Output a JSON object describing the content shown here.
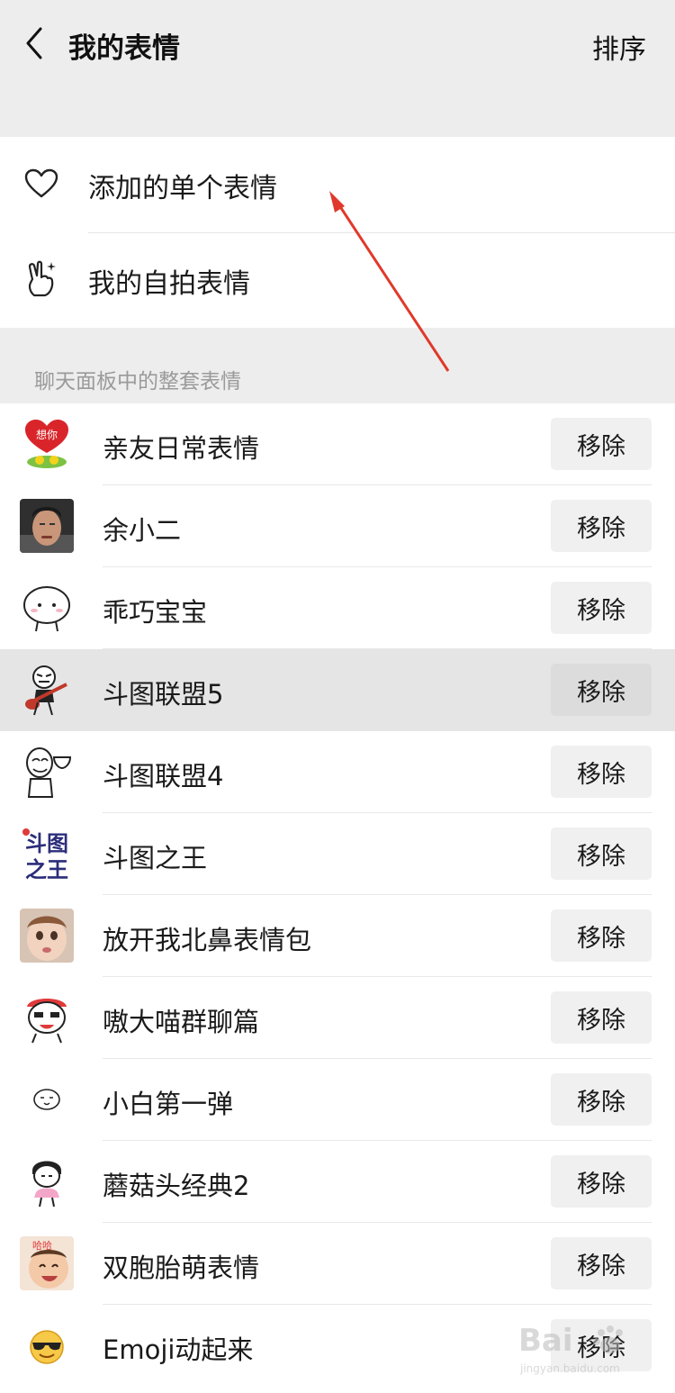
{
  "header": {
    "title": "我的表情",
    "sort_label": "排序"
  },
  "top_items": [
    {
      "label": "添加的单个表情",
      "icon": "heart-icon"
    },
    {
      "label": "我的自拍表情",
      "icon": "selfie-hand-icon"
    }
  ],
  "section": {
    "title": "聊天面板中的整套表情"
  },
  "stickers": [
    {
      "name": "亲友日常表情",
      "remove_label": "移除",
      "thumb": "heart-sticker"
    },
    {
      "name": "余小二",
      "remove_label": "移除",
      "thumb": "man-photo"
    },
    {
      "name": "乖巧宝宝",
      "remove_label": "移除",
      "thumb": "white-bun"
    },
    {
      "name": "斗图联盟5",
      "remove_label": "移除",
      "thumb": "guitar-stickman"
    },
    {
      "name": "斗图联盟4",
      "remove_label": "移除",
      "thumb": "bowl-stickman"
    },
    {
      "name": "斗图之王",
      "remove_label": "移除",
      "thumb": "text-logo"
    },
    {
      "name": "放开我北鼻表情包",
      "remove_label": "移除",
      "thumb": "baby-photo"
    },
    {
      "name": "嗷大喵群聊篇",
      "remove_label": "移除",
      "thumb": "cat-cartoon"
    },
    {
      "name": "小白第一弹",
      "remove_label": "移除",
      "thumb": "small-white-face"
    },
    {
      "name": "蘑菇头经典2",
      "remove_label": "移除",
      "thumb": "mushroom-head"
    },
    {
      "name": "双胞胎萌表情",
      "remove_label": "移除",
      "thumb": "twin-baby-photo"
    },
    {
      "name": "Emoji动起来",
      "remove_label": "移除",
      "thumb": "sunglasses-emoji"
    }
  ],
  "thumb_text": {
    "heart": "想你",
    "logo_top": "斗图",
    "logo_bottom": "之王",
    "cat_tag": "哈哈"
  },
  "highlighted_index": 3,
  "annotation_color": "#e0392b",
  "watermark": {
    "main": "Bai",
    "sub": "jingyan.baidu.com"
  }
}
